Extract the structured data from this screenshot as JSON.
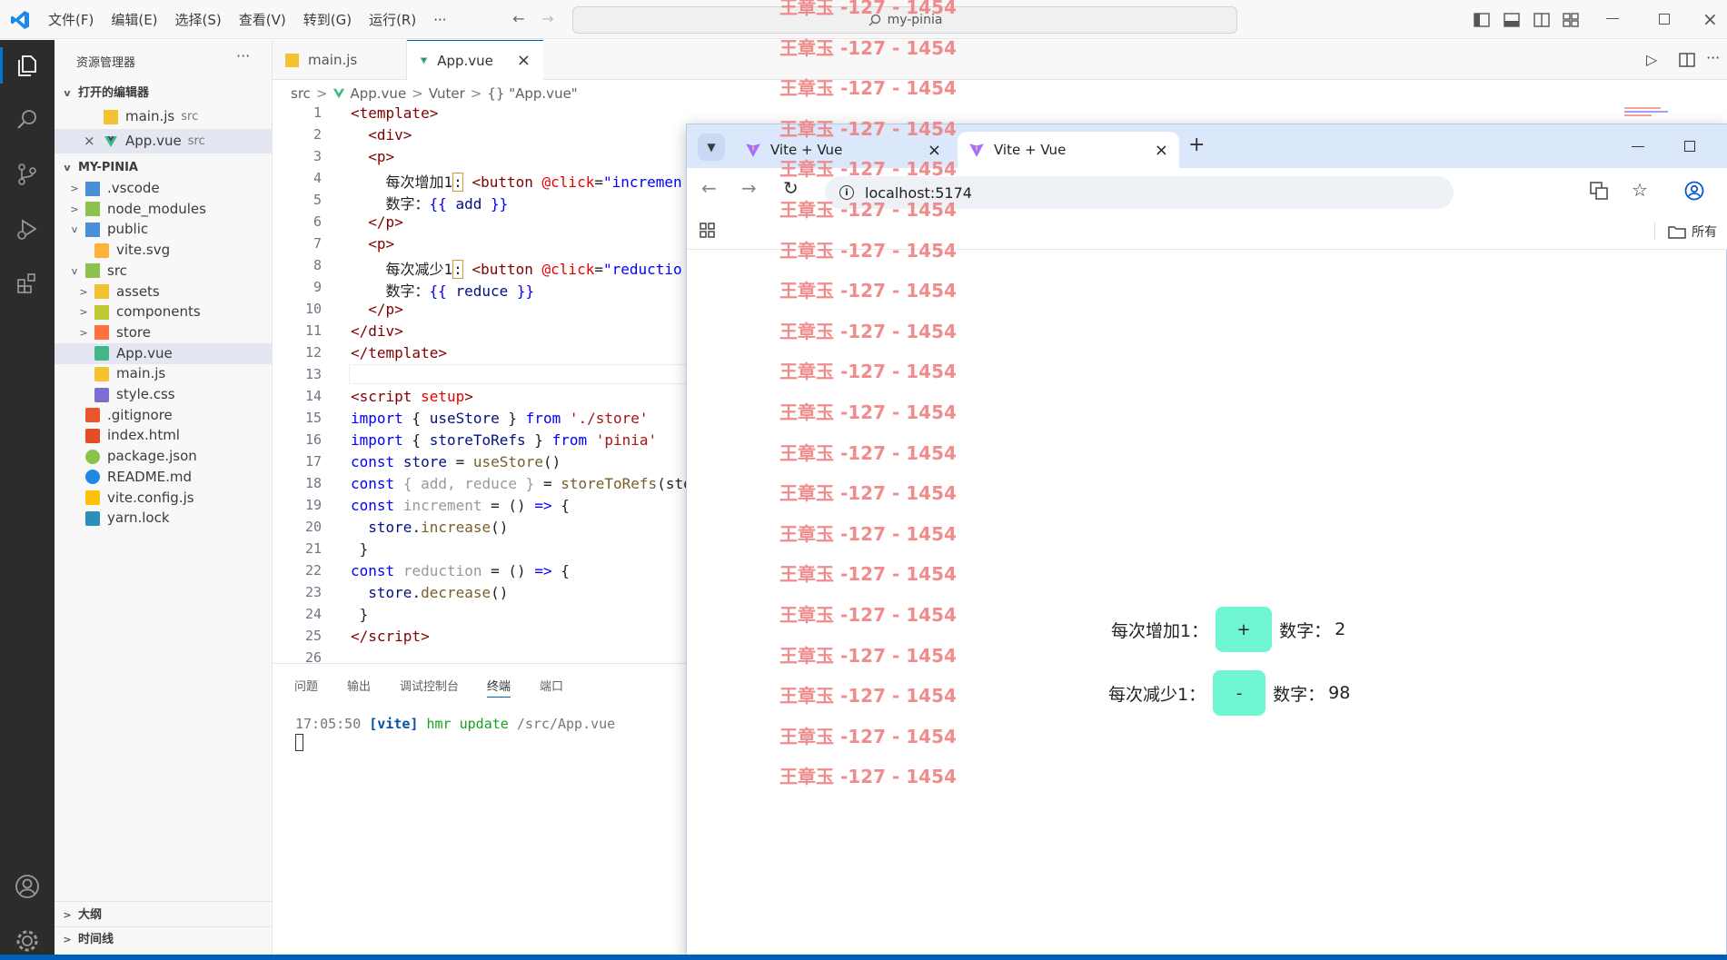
{
  "menu": [
    "文件(F)",
    "编辑(E)",
    "选择(S)",
    "查看(V)",
    "转到(G)",
    "运行(R)",
    "···"
  ],
  "command_center": "my-pinia",
  "sidebar": {
    "title": "资源管理器",
    "open_editors_label": "打开的编辑器",
    "open_editors": [
      {
        "name": "main.js",
        "dir": "src"
      },
      {
        "name": "App.vue",
        "dir": "src"
      }
    ],
    "project_label": "MY-PINIA",
    "tree": [
      {
        "name": ".vscode",
        "kind": "folder",
        "level": 0,
        "chev": ">"
      },
      {
        "name": "node_modules",
        "kind": "folder",
        "level": 0,
        "chev": ">"
      },
      {
        "name": "public",
        "kind": "folder",
        "level": 0,
        "chev": "v"
      },
      {
        "name": "vite.svg",
        "kind": "svg",
        "level": 1
      },
      {
        "name": "src",
        "kind": "folder",
        "level": 0,
        "chev": "v"
      },
      {
        "name": "assets",
        "kind": "folder",
        "level": 1,
        "chev": ">"
      },
      {
        "name": "components",
        "kind": "folder",
        "level": 1,
        "chev": ">"
      },
      {
        "name": "store",
        "kind": "folder",
        "level": 1,
        "chev": ">"
      },
      {
        "name": "App.vue",
        "kind": "vue",
        "level": 1
      },
      {
        "name": "main.js",
        "kind": "js",
        "level": 1
      },
      {
        "name": "style.css",
        "kind": "css",
        "level": 1
      },
      {
        "name": ".gitignore",
        "kind": "git",
        "level": 0
      },
      {
        "name": "index.html",
        "kind": "html",
        "level": 0
      },
      {
        "name": "package.json",
        "kind": "json",
        "level": 0
      },
      {
        "name": "README.md",
        "kind": "info",
        "level": 0
      },
      {
        "name": "vite.config.js",
        "kind": "vite",
        "level": 0
      },
      {
        "name": "yarn.lock",
        "kind": "yarn",
        "level": 0
      }
    ],
    "outline_label": "大纲",
    "timeline_label": "时间线"
  },
  "editor": {
    "tabs": [
      "main.js",
      "App.vue"
    ],
    "breadcrumb": [
      "src",
      "App.vue",
      "Vuter",
      "{} \"App.vue\""
    ],
    "line_numbers": [
      "1",
      "2",
      "3",
      "4",
      "5",
      "6",
      "7",
      "8",
      "9",
      "10",
      "11",
      "12",
      "13",
      "14",
      "15",
      "16",
      "17",
      "18",
      "19",
      "20",
      "21",
      "22",
      "23",
      "24",
      "25",
      "26"
    ]
  },
  "panel": {
    "tabs": [
      "问题",
      "输出",
      "调试控制台",
      "终端",
      "端口"
    ],
    "term_time": "17:05:50",
    "term_tag": "[vite]",
    "term_msg": "hmr update",
    "term_path": "/src/App.vue"
  },
  "browser": {
    "tab1": "Vite + Vue",
    "tab2": "Vite + Vue",
    "new_tab": "+",
    "address": "localhost:5174",
    "bookmarks": "所有",
    "increase_label": "每次增加1：",
    "increase_btn": "+",
    "add_label": "数字：",
    "add_value": "2",
    "decrease_label": "每次减少1：",
    "decrease_btn": "-",
    "reduce_label": "数字：",
    "reduce_value": "98"
  },
  "watermark": "王章玉 -127 - 1454"
}
